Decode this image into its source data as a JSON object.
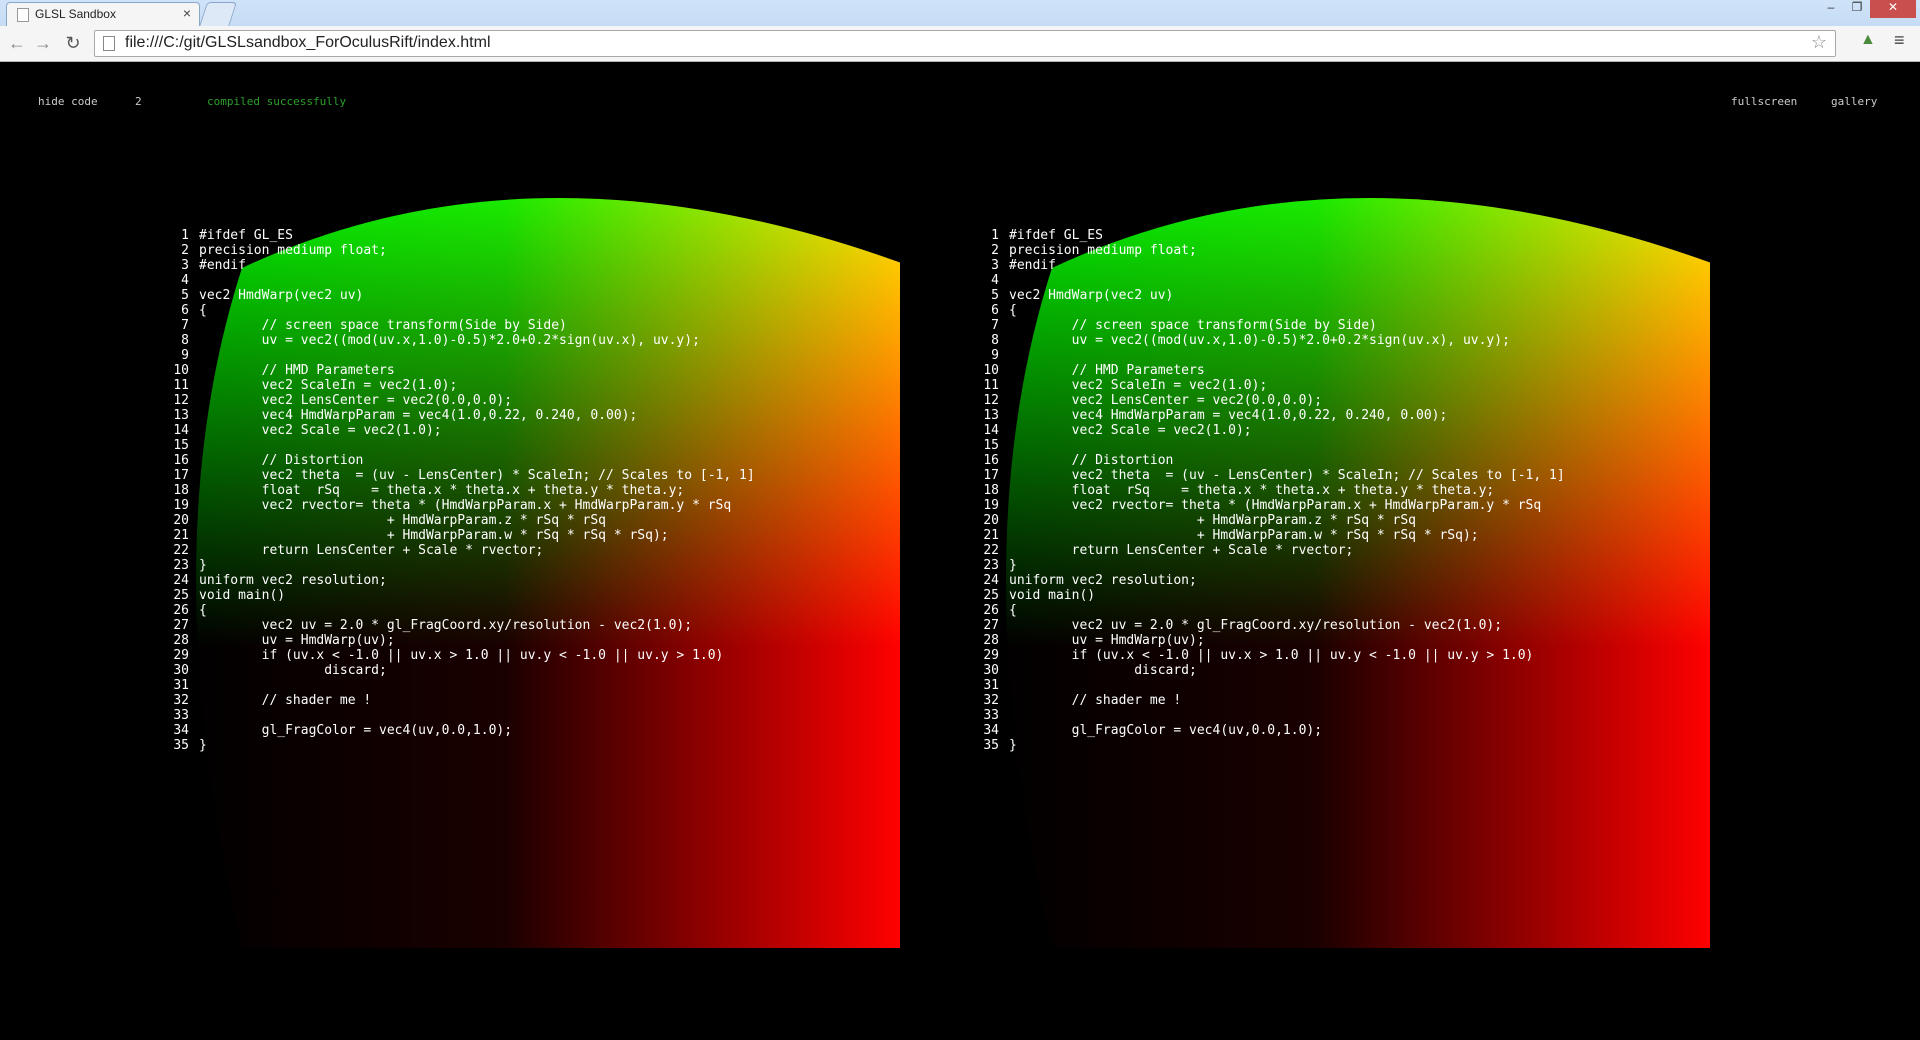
{
  "browser": {
    "tab_title": "GLSL Sandbox",
    "url": "file:///C:/git/GLSLsandbox_ForOculusRift/index.html",
    "back_icon": "back-arrow-icon",
    "forward_icon": "forward-arrow-icon",
    "reload_icon": "reload-icon"
  },
  "topbar": {
    "hide_code": "hide code",
    "quality": "2",
    "status": "compiled successfully",
    "fullscreen": "fullscreen",
    "gallery": "gallery"
  },
  "colors": {
    "status_green": "#2aa02a",
    "distortion_red": "#ff0000",
    "distortion_green": "#00ff00",
    "distortion_yellow": "#ffff00"
  },
  "code": [
    "#ifdef GL_ES",
    "precision mediump float;",
    "#endif",
    "",
    "vec2 HmdWarp(vec2 uv)",
    "{",
    "\t// screen space transform(Side by Side)",
    "\tuv = vec2((mod(uv.x,1.0)-0.5)*2.0+0.2*sign(uv.x), uv.y);",
    "",
    "\t// HMD Parameters",
    "\tvec2 ScaleIn = vec2(1.0);",
    "\tvec2 LensCenter = vec2(0.0,0.0);",
    "\tvec4 HmdWarpParam = vec4(1.0,0.22, 0.240, 0.00);",
    "\tvec2 Scale = vec2(1.0);",
    "",
    "\t// Distortion",
    "\tvec2 theta  = (uv - LensCenter) * ScaleIn; // Scales to [-1, 1]",
    "\tfloat  rSq    = theta.x * theta.x + theta.y * theta.y;",
    "\tvec2 rvector= theta * (HmdWarpParam.x + HmdWarpParam.y * rSq",
    "\t\t\t+ HmdWarpParam.z * rSq * rSq",
    "\t\t\t+ HmdWarpParam.w * rSq * rSq * rSq);",
    "\treturn LensCenter + Scale * rvector;",
    "}",
    "uniform vec2 resolution;",
    "void main()",
    "{",
    "\tvec2 uv = 2.0 * gl_FragCoord.xy/resolution - vec2(1.0);",
    "\tuv = HmdWarp(uv);",
    "\tif (uv.x < -1.0 || uv.x > 1.0 || uv.y < -1.0 || uv.y > 1.0)",
    "\t\tdiscard;",
    "",
    "\t// shader me !",
    "",
    "\tgl_FragColor = vec4(uv,0.0,1.0);",
    "}"
  ]
}
